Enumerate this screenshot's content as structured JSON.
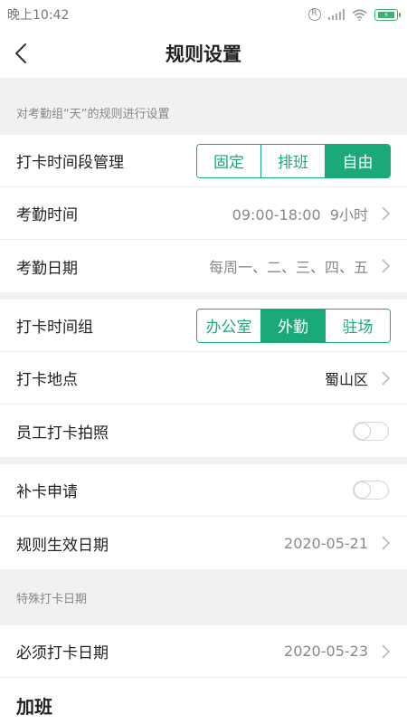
{
  "status": {
    "time": "晚上10:42"
  },
  "nav": {
    "title": "规则设置"
  },
  "section1": {
    "label": "对考勤组“天”的规则进行设置"
  },
  "punch_period": {
    "label": "打卡时间段管理",
    "options": [
      "固定",
      "排班",
      "自由"
    ],
    "selected": "自由"
  },
  "attendance_time": {
    "label": "考勤时间",
    "value": "09:00-18:00  9小时"
  },
  "attendance_date": {
    "label": "考勤日期",
    "value": "每周一、二、三、四、五"
  },
  "punch_group": {
    "label": "打卡时间组",
    "options": [
      "办公室",
      "外勤",
      "驻场"
    ],
    "selected": "外勤"
  },
  "punch_location": {
    "label": "打卡地点",
    "value": "蜀山区"
  },
  "photo": {
    "label": "员工打卡拍照",
    "enabled": false
  },
  "makeup": {
    "label": "补卡申请",
    "enabled": false
  },
  "effective_date": {
    "label": "规则生效日期",
    "value": "2020-05-21"
  },
  "section2": {
    "label": "特殊打卡日期"
  },
  "required_date": {
    "label": "必须打卡日期",
    "value": "2020-05-23"
  },
  "overtime": {
    "label": "加班"
  },
  "colors": {
    "accent": "#1aa97a",
    "background": "#f1f1f1"
  }
}
